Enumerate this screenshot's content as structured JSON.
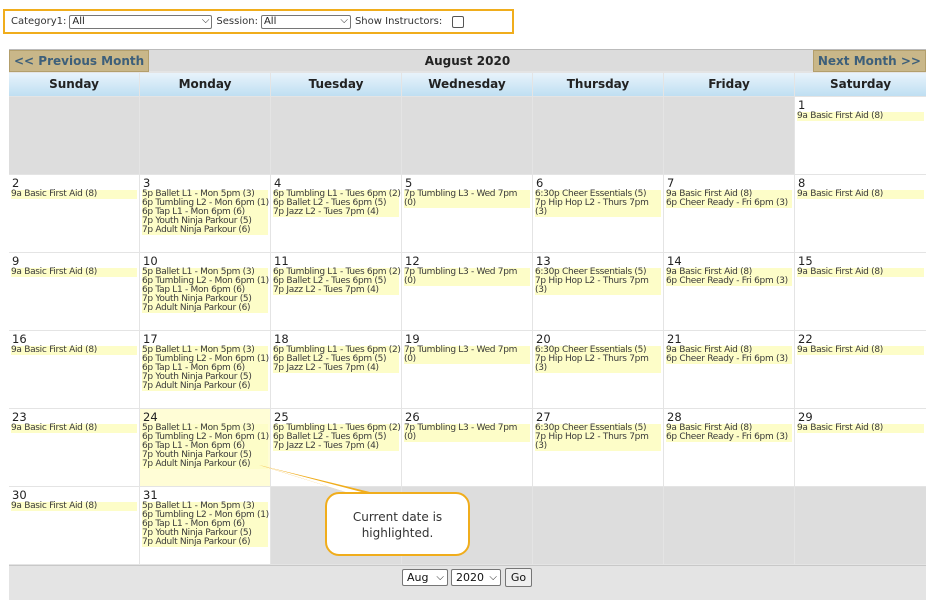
{
  "filters": {
    "category_label": "Category1:",
    "category_value": "All",
    "session_label": "Session:",
    "session_value": "All",
    "instructors_label": "Show Instructors:"
  },
  "nav": {
    "prev": "<< Previous Month",
    "next": "Next Month >>",
    "month_title": "August 2020"
  },
  "day_headers": [
    "Sunday",
    "Monday",
    "Tuesday",
    "Wednesday",
    "Thursday",
    "Friday",
    "Saturday"
  ],
  "weeks": [
    [
      {
        "day": "",
        "events": []
      },
      {
        "day": "",
        "events": []
      },
      {
        "day": "",
        "events": []
      },
      {
        "day": "",
        "events": []
      },
      {
        "day": "",
        "events": []
      },
      {
        "day": "",
        "events": []
      },
      {
        "day": "1",
        "events": [
          "9a Basic First Aid (8)"
        ]
      }
    ],
    [
      {
        "day": "2",
        "events": [
          "9a Basic First Aid (8)"
        ]
      },
      {
        "day": "3",
        "events": [
          "5p Ballet L1 - Mon 5pm (3)",
          "6p Tumbling L2 - Mon 6pm (1)",
          "6p Tap L1 - Mon 6pm (6)",
          "7p Youth Ninja Parkour (5)",
          "7p Adult Ninja Parkour (6)"
        ]
      },
      {
        "day": "4",
        "events": [
          "6p Tumbling L1 - Tues 6pm (2)",
          "6p Ballet L2 - Tues 6pm (5)",
          "7p Jazz L2 - Tues 7pm (4)"
        ]
      },
      {
        "day": "5",
        "events": [
          "7p Tumbling L3 - Wed 7pm",
          "(0)"
        ]
      },
      {
        "day": "6",
        "events": [
          "6:30p Cheer Essentials (5)",
          "7p Hip Hop L2 - Thurs 7pm",
          "(3)"
        ]
      },
      {
        "day": "7",
        "events": [
          "9a Basic First Aid (8)",
          "6p Cheer Ready - Fri 6pm (3)"
        ]
      },
      {
        "day": "8",
        "events": [
          "9a Basic First Aid (8)"
        ]
      }
    ],
    [
      {
        "day": "9",
        "events": [
          "9a Basic First Aid (8)"
        ]
      },
      {
        "day": "10",
        "events": [
          "5p Ballet L1 - Mon 5pm (3)",
          "6p Tumbling L2 - Mon 6pm (1)",
          "6p Tap L1 - Mon 6pm (6)",
          "7p Youth Ninja Parkour (5)",
          "7p Adult Ninja Parkour (6)"
        ]
      },
      {
        "day": "11",
        "events": [
          "6p Tumbling L1 - Tues 6pm (2)",
          "6p Ballet L2 - Tues 6pm (5)",
          "7p Jazz L2 - Tues 7pm (4)"
        ]
      },
      {
        "day": "12",
        "events": [
          "7p Tumbling L3 - Wed 7pm",
          "(0)"
        ]
      },
      {
        "day": "13",
        "events": [
          "6:30p Cheer Essentials (5)",
          "7p Hip Hop L2 - Thurs 7pm",
          "(3)"
        ]
      },
      {
        "day": "14",
        "events": [
          "9a Basic First Aid (8)",
          "6p Cheer Ready - Fri 6pm (3)"
        ]
      },
      {
        "day": "15",
        "events": [
          "9a Basic First Aid (8)"
        ]
      }
    ],
    [
      {
        "day": "16",
        "events": [
          "9a Basic First Aid (8)"
        ]
      },
      {
        "day": "17",
        "events": [
          "5p Ballet L1 - Mon 5pm (3)",
          "6p Tumbling L2 - Mon 6pm (1)",
          "6p Tap L1 - Mon 6pm (6)",
          "7p Youth Ninja Parkour (5)",
          "7p Adult Ninja Parkour (6)"
        ]
      },
      {
        "day": "18",
        "events": [
          "6p Tumbling L1 - Tues 6pm (2)",
          "6p Ballet L2 - Tues 6pm (5)",
          "7p Jazz L2 - Tues 7pm (4)"
        ]
      },
      {
        "day": "19",
        "events": [
          "7p Tumbling L3 - Wed 7pm",
          "(0)"
        ]
      },
      {
        "day": "20",
        "events": [
          "6:30p Cheer Essentials (5)",
          "7p Hip Hop L2 - Thurs 7pm",
          "(3)"
        ]
      },
      {
        "day": "21",
        "events": [
          "9a Basic First Aid (8)",
          "6p Cheer Ready - Fri 6pm (3)"
        ]
      },
      {
        "day": "22",
        "events": [
          "9a Basic First Aid (8)"
        ]
      }
    ],
    [
      {
        "day": "23",
        "events": [
          "9a Basic First Aid (8)"
        ]
      },
      {
        "day": "24",
        "today": true,
        "events": [
          "5p Ballet L1 - Mon 5pm (3)",
          "6p Tumbling L2 - Mon 6pm (1)",
          "6p Tap L1 - Mon 6pm (6)",
          "7p Youth Ninja Parkour (5)",
          "7p Adult Ninja Parkour (6)"
        ]
      },
      {
        "day": "25",
        "events": [
          "6p Tumbling L1 - Tues 6pm (2)",
          "6p Ballet L2 - Tues 6pm (5)",
          "7p Jazz L2 - Tues 7pm (4)"
        ]
      },
      {
        "day": "26",
        "events": [
          "7p Tumbling L3 - Wed 7pm",
          "(0)"
        ]
      },
      {
        "day": "27",
        "events": [
          "6:30p Cheer Essentials (5)",
          "7p Hip Hop L2 - Thurs 7pm",
          "(3)"
        ]
      },
      {
        "day": "28",
        "events": [
          "9a Basic First Aid (8)",
          "6p Cheer Ready - Fri 6pm (3)"
        ]
      },
      {
        "day": "29",
        "events": [
          "9a Basic First Aid (8)"
        ]
      }
    ],
    [
      {
        "day": "30",
        "events": [
          "9a Basic First Aid (8)"
        ]
      },
      {
        "day": "31",
        "events": [
          "5p Ballet L1 - Mon 5pm (3)",
          "6p Tumbling L2 - Mon 6pm (1)",
          "6p Tap L1 - Mon 6pm (6)",
          "7p Youth Ninja Parkour (5)",
          "7p Adult Ninja Parkour (6)"
        ]
      },
      {
        "day": "",
        "events": []
      },
      {
        "day": "",
        "events": []
      },
      {
        "day": "",
        "events": []
      },
      {
        "day": "",
        "events": []
      },
      {
        "day": "",
        "events": []
      }
    ]
  ],
  "footer": {
    "month_select": "Aug",
    "year_select": "2020",
    "go_label": "Go"
  },
  "callout": {
    "text_line1": "Current date is",
    "text_line2": "highlighted."
  },
  "colors": {
    "accent_orange": "#f0ad1c",
    "today_bg": "#fffdd6",
    "event_bg": "#fdfdc8",
    "nav_button": "#c9b789"
  }
}
